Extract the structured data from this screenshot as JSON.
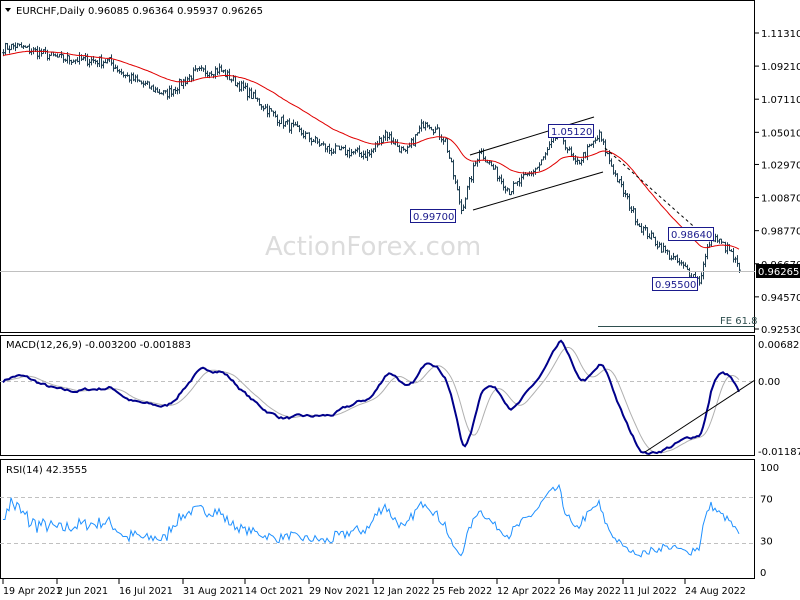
{
  "header": {
    "symbol": "EURCHF,Daily",
    "ohlc": "0.96085 0.96364 0.95937 0.96265"
  },
  "watermark": "ActionForex.com",
  "current_price": "0.96265",
  "annotations": {
    "low1": "0.99700",
    "high1": "1.05120",
    "high2": "0.98640",
    "low2": "0.95500",
    "fe": "FE 61.8"
  },
  "macd_label": "MACD(12,26,9) -0.003200 -0.001883",
  "rsi_label": "RSI(14) 42.3555",
  "colors": {
    "bars": "#1f3f52",
    "ma": "#e00000",
    "macd": "#00008b",
    "signal": "#b0b0b0",
    "rsi": "#1e90ff",
    "box": "#1a1a8c"
  },
  "chart_data": {
    "type": "line",
    "title": "EURCHF, Daily",
    "price_axis": {
      "ticks": [
        "1.11310",
        "1.09210",
        "1.07110",
        "1.05010",
        "1.02970",
        "1.00870",
        "0.98770",
        "0.96670",
        "0.94570",
        "0.92530"
      ],
      "range": [
        0.9253,
        1.1131
      ]
    },
    "macd_axis": {
      "ticks": [
        "0.006823",
        "0.00",
        "-0.011874"
      ],
      "range": [
        -0.011874,
        0.006823
      ]
    },
    "rsi_axis": {
      "ticks": [
        "100",
        "70",
        "30",
        "0"
      ],
      "range": [
        0,
        100
      ]
    },
    "x_labels": [
      "19 Apr 2021",
      "2 Jun 2021",
      "16 Jul 2021",
      "31 Aug 2021",
      "14 Oct 2021",
      "29 Nov 2021",
      "12 Jan 2022",
      "25 Feb 2022",
      "12 Apr 2022",
      "26 May 2022",
      "11 Jul 2022",
      "24 Aug 2022"
    ],
    "x_label_bar_index": [
      0,
      27,
      58,
      90,
      121,
      153,
      185,
      215,
      247,
      278,
      310,
      341
    ],
    "price_waypoints": [
      [
        0,
        1.1036
      ],
      [
        6,
        1.105
      ],
      [
        28,
        1.097
      ],
      [
        53,
        1.095
      ],
      [
        61,
        1.086
      ],
      [
        81,
        1.074
      ],
      [
        96,
        1.088
      ],
      [
        108,
        1.09
      ],
      [
        118,
        1.08
      ],
      [
        138,
        1.058
      ],
      [
        163,
        1.039
      ],
      [
        183,
        1.036
      ],
      [
        191,
        1.05
      ],
      [
        201,
        1.036
      ],
      [
        211,
        1.058
      ],
      [
        221,
        1.045
      ],
      [
        229,
        1.001
      ],
      [
        238,
        1.039
      ],
      [
        253,
        1.013
      ],
      [
        268,
        1.029
      ],
      [
        278,
        1.051
      ],
      [
        286,
        1.029
      ],
      [
        298,
        1.048
      ],
      [
        306,
        1.023
      ],
      [
        318,
        0.991
      ],
      [
        333,
        0.972
      ],
      [
        348,
        0.956
      ],
      [
        354,
        0.985
      ],
      [
        363,
        0.975
      ],
      [
        368,
        0.9626
      ]
    ],
    "ma_period": 50
  }
}
